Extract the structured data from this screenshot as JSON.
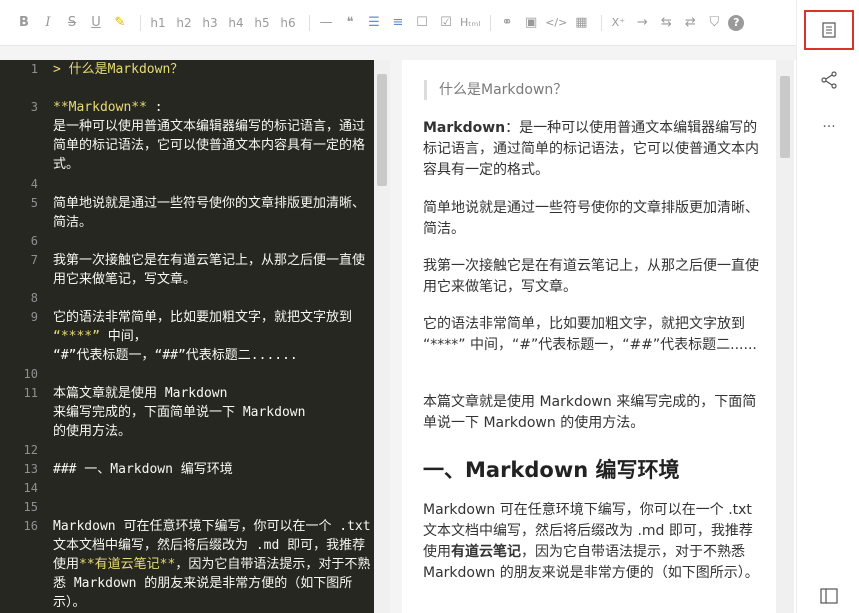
{
  "toolbar": {
    "bold": "B",
    "italic": "I",
    "strike": "S",
    "underline": "U",
    "marker": "✎",
    "h1": "h1",
    "h2": "h2",
    "h3": "h3",
    "h4": "h4",
    "h5": "h5",
    "h6": "h6",
    "hr": "—",
    "quote": "❝",
    "ul": "☰",
    "ol": "≡",
    "checkbox_empty": "☐",
    "checkbox_checked": "☑",
    "html": "Hₜₘₗ",
    "link": "⚭",
    "image": "▣",
    "code": "</>",
    "table": "▦",
    "superscript": "X⁺",
    "arrow_right": "→",
    "sync": "⇆",
    "layout": "⇄",
    "shirt": "⛉",
    "help": "?"
  },
  "editor": {
    "lines": [
      {
        "n": "1",
        "segments": [
          {
            "t": "> 什么是Markdown？",
            "c": "yellow"
          }
        ]
      },
      {
        "n": "",
        "segments": []
      },
      {
        "n": "3",
        "segments": [
          {
            "t": "**Markdown**",
            "c": "yellow"
          },
          {
            "t": " :",
            "c": ""
          }
        ]
      },
      {
        "n": "",
        "segments": [
          {
            "t": "是一种可以使用普通文本编辑器编写的标记语言，通过简单的标记语法，它可以使普通文本内容具有一定的格式。",
            "c": ""
          }
        ]
      },
      {
        "n": "4",
        "segments": []
      },
      {
        "n": "5",
        "segments": [
          {
            "t": "简单地说就是通过一些符号使你的文章排版更加清晰、简洁。",
            "c": ""
          }
        ]
      },
      {
        "n": "6",
        "segments": []
      },
      {
        "n": "7",
        "segments": [
          {
            "t": "我第一次接触它是在有道云笔记上，从那之后便一直使用它来做笔记，写文章。",
            "c": ""
          }
        ]
      },
      {
        "n": "8",
        "segments": []
      },
      {
        "n": "9",
        "segments": [
          {
            "t": "它的语法非常简单，比如要加粗文字，就把文字放到 ",
            "c": ""
          },
          {
            "t": "“****”",
            "c": "yellow"
          },
          {
            "t": " 中间，\n“#”代表标题一，“##”代表标题二......",
            "c": ""
          }
        ]
      },
      {
        "n": "10",
        "segments": []
      },
      {
        "n": "11",
        "segments": [
          {
            "t": "本篇文章就是使用 Markdown\n来编写完成的，下面简单说一下 Markdown\n的使用方法。",
            "c": ""
          }
        ]
      },
      {
        "n": "12",
        "segments": []
      },
      {
        "n": "13",
        "segments": [
          {
            "t": "### 一、Markdown 编写环境",
            "c": ""
          }
        ]
      },
      {
        "n": "14",
        "segments": []
      },
      {
        "n": "15",
        "segments": []
      },
      {
        "n": "16",
        "segments": [
          {
            "t": "Markdown 可在任意环境下编写，你可以在一个 .txt 文本文档中编写，然后将后缀改为 .md 即可，我推荐使用",
            "c": ""
          },
          {
            "t": "**有道云笔记**",
            "c": "yellow"
          },
          {
            "t": "，因为它自带语法提示，对于不熟悉 Markdown 的朋友来说是非常方便的（如下图所示）。",
            "c": ""
          }
        ]
      }
    ]
  },
  "preview": {
    "quote": "什么是Markdown？",
    "p1_bold": "Markdown",
    "p1_rest": "：是一种可以使用普通文本编辑器编写的标记语言，通过简单的标记语法，它可以使普通文本内容具有一定的格式。",
    "p2": "简单地说就是通过一些符号使你的文章排版更加清晰、简洁。",
    "p3": "我第一次接触它是在有道云笔记上，从那之后便一直使用它来做笔记，写文章。",
    "p4": "它的语法非常简单，比如要加粗文字，就把文字放到 “****” 中间，“#”代表标题一，“##”代表标题二......",
    "p5": "本篇文章就是使用 Markdown 来编写完成的，下面简单说一下 Markdown 的使用方法。",
    "h1": "一、Markdown 编写环境",
    "p6_a": "Markdown 可在任意环境下编写，你可以在一个 .txt 文本文档中编写，然后将后缀改为 .md 即可，我推荐使用",
    "p6_bold": "有道云笔记",
    "p6_b": "，因为它自带语法提示，对于不熟悉 Markdown 的朋友来说是非常方便的（如下图所示）。"
  },
  "right_panel": {
    "outline": "☰",
    "share": "⋲",
    "more": "···",
    "sidebar": "◫"
  },
  "colors": {
    "editor_bg": "#262721",
    "editor_text": "#f8f8f2",
    "editor_yellow": "#e6db74",
    "selected_border": "#d9342b"
  }
}
